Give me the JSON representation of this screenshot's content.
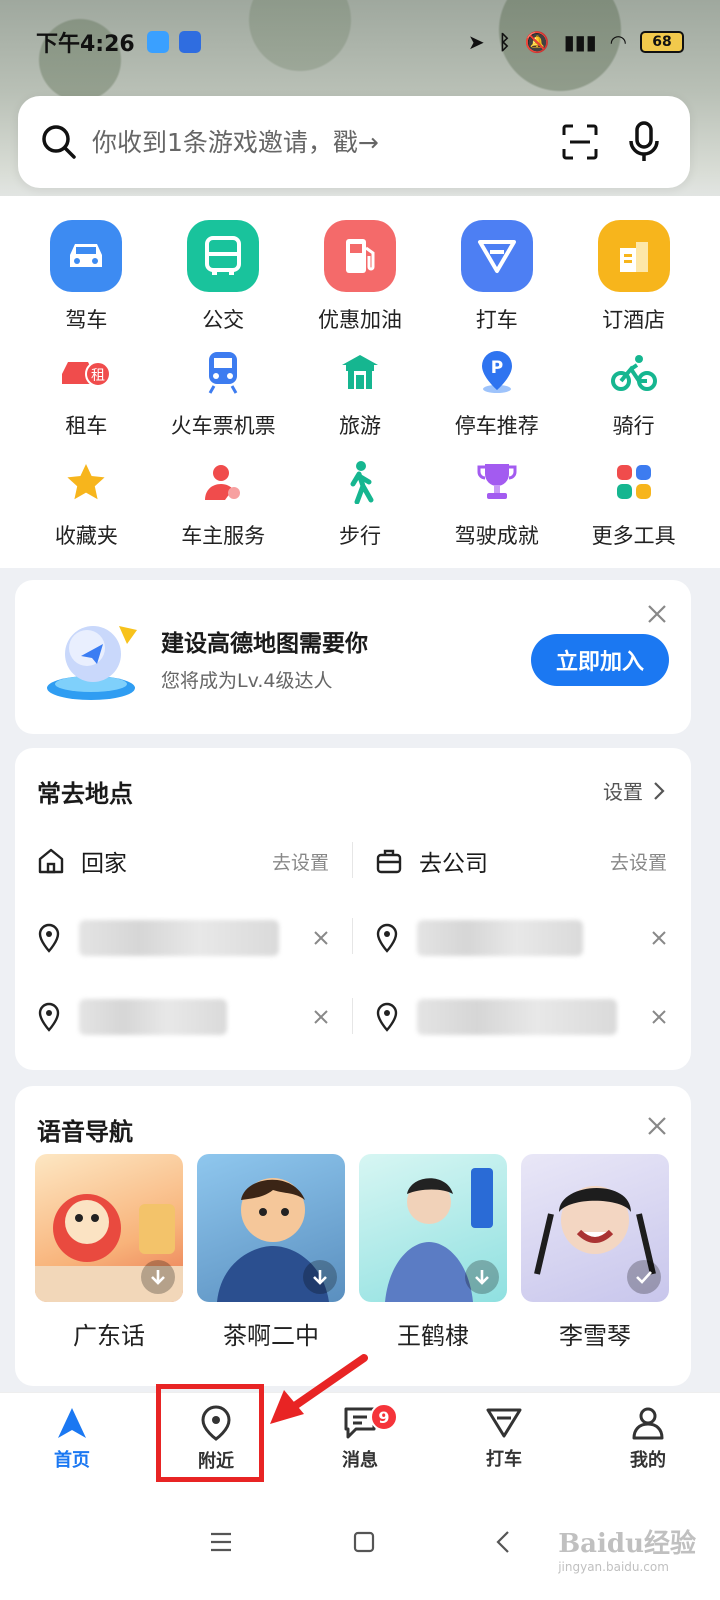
{
  "status_bar": {
    "time": "下午4:26",
    "battery": "68"
  },
  "search": {
    "placeholder": "你收到1条游戏邀请，戳→"
  },
  "tools_main": [
    {
      "label": "驾车",
      "icon": "car-icon",
      "color": "#3d8bf2"
    },
    {
      "label": "公交",
      "icon": "bus-icon",
      "color": "#19c39c"
    },
    {
      "label": "优惠加油",
      "icon": "fuel-icon",
      "color": "#f46a6a"
    },
    {
      "label": "打车",
      "icon": "taxi-icon",
      "color": "#4d7ff3"
    },
    {
      "label": "订酒店",
      "icon": "hotel-icon",
      "color": "#f7b51c"
    }
  ],
  "tools_row2": [
    {
      "label": "租车",
      "icon": "rent-car-icon"
    },
    {
      "label": "火车票机票",
      "icon": "train-icon"
    },
    {
      "label": "旅游",
      "icon": "travel-icon"
    },
    {
      "label": "停车推荐",
      "icon": "parking-icon"
    },
    {
      "label": "骑行",
      "icon": "bike-icon"
    }
  ],
  "tools_row3": [
    {
      "label": "收藏夹",
      "icon": "star-icon"
    },
    {
      "label": "车主服务",
      "icon": "car-owner-icon"
    },
    {
      "label": "步行",
      "icon": "walk-icon"
    },
    {
      "label": "驾驶成就",
      "icon": "trophy-icon"
    },
    {
      "label": "更多工具",
      "icon": "grid-icon"
    }
  ],
  "banner": {
    "title": "建设高德地图需要你",
    "subtitle": "您将成为Lv.4级达人",
    "button": "立即加入"
  },
  "places": {
    "title": "常去地点",
    "settings": "设置",
    "home": "回家",
    "company": "去公司",
    "set_action": "去设置"
  },
  "voice_nav": {
    "title": "语音导航",
    "items": [
      {
        "label": "广东话"
      },
      {
        "label": "茶啊二中"
      },
      {
        "label": "王鹤棣"
      },
      {
        "label": "李雪琴"
      }
    ]
  },
  "bottom_nav": [
    {
      "label": "首页"
    },
    {
      "label": "附近"
    },
    {
      "label": "消息",
      "badge": "9"
    },
    {
      "label": "打车"
    },
    {
      "label": "我的"
    }
  ],
  "watermark": {
    "main": "Baidu经验",
    "sub": "jingyan.baidu.com"
  }
}
